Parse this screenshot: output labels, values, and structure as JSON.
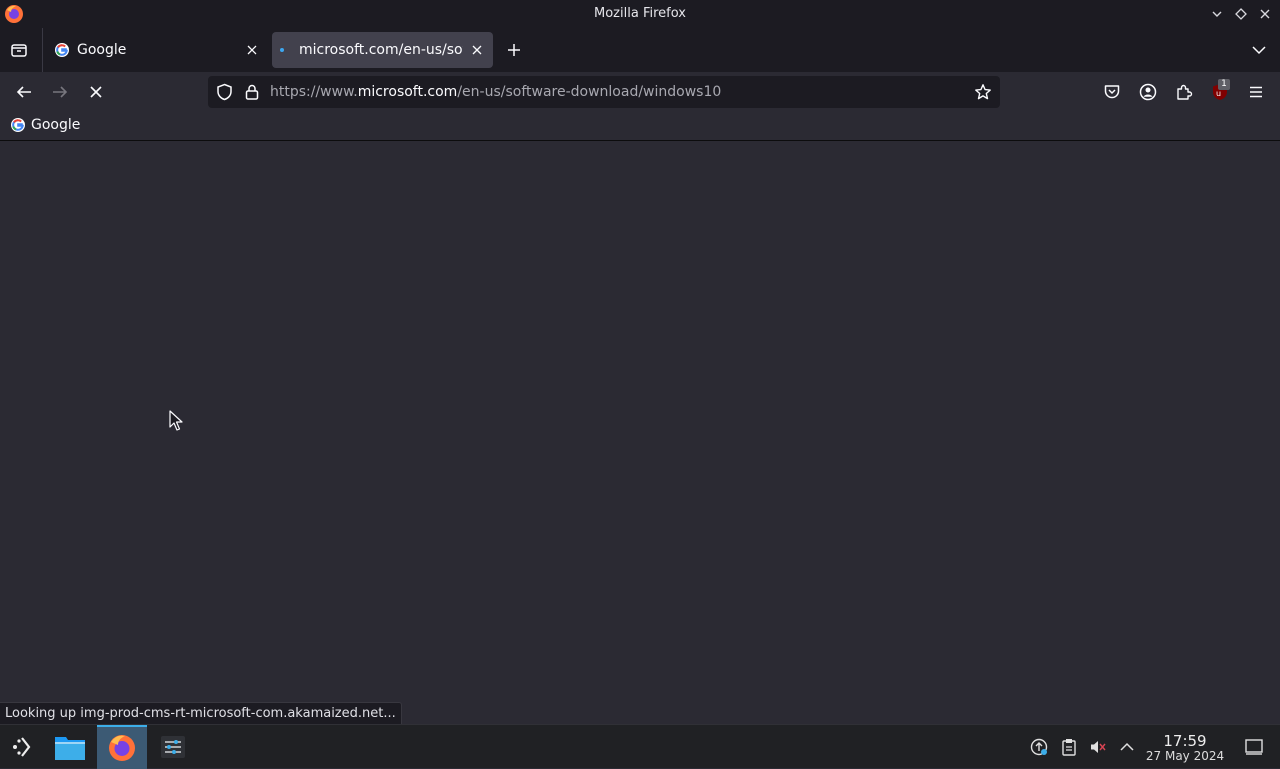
{
  "window": {
    "title": "Mozilla Firefox"
  },
  "tabs": [
    {
      "label": "Google",
      "active": false
    },
    {
      "label": "microsoft.com/en-us/soft",
      "active": true
    }
  ],
  "url": {
    "prefix": "https://www.",
    "host": "microsoft.com",
    "path": "/en-us/software-download/windows10"
  },
  "bookmarks": [
    {
      "label": "Google"
    }
  ],
  "status": {
    "text": "Looking up img-prod-cms-rt-microsoft-com.akamaized.net..."
  },
  "extensions": {
    "ublock_badge": "1"
  },
  "clock": {
    "time": "17:59",
    "date": "27 May 2024"
  },
  "colors": {
    "accent": "#3daee9",
    "toolbar": "#2b2a33",
    "tabstrip": "#1c1b22",
    "ublock": "#800000"
  }
}
